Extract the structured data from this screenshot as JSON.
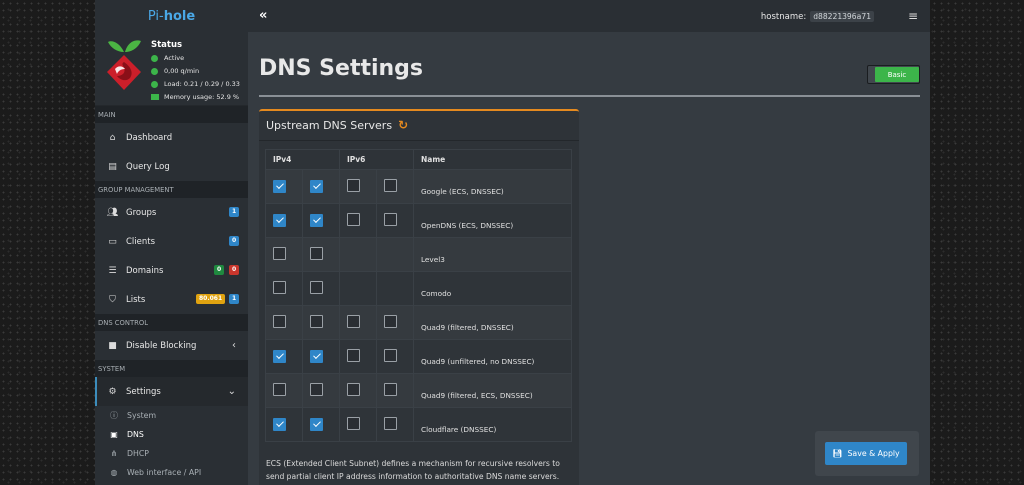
{
  "brand": {
    "prefix": "Pi-",
    "name": "hole"
  },
  "status": {
    "title": "Status",
    "active": "Active",
    "qpm": "0,00 q/min",
    "load": "Load: 0.21 / 0.29 / 0.33",
    "memory": "Memory usage: 52.9 %"
  },
  "sidebar": {
    "sections": {
      "main": "MAIN",
      "group": "GROUP MANAGEMENT",
      "dns_control": "DNS CONTROL",
      "system": "SYSTEM"
    },
    "items": {
      "dashboard": "Dashboard",
      "query_log": "Query Log",
      "groups": "Groups",
      "groups_badge": "1",
      "clients": "Clients",
      "clients_badge": "0",
      "domains": "Domains",
      "domains_badge_allow": "0",
      "domains_badge_deny": "0",
      "lists": "Lists",
      "lists_badge_domains": "80.061",
      "lists_badge_count": "1",
      "disable_blocking": "Disable Blocking",
      "settings": "Settings"
    },
    "sub": {
      "system": "System",
      "dns": "DNS",
      "dhcp": "DHCP",
      "web": "Web interface / API"
    }
  },
  "header": {
    "hostname_label": "hostname:",
    "hostname_value": "d88221396a71"
  },
  "page": {
    "title": "DNS Settings",
    "mode": "Basic"
  },
  "upstream": {
    "title": "Upstream DNS Servers",
    "columns": {
      "ipv4": "IPv4",
      "ipv6": "IPv6",
      "name": "Name"
    },
    "rows": [
      {
        "name": "Google (ECS, DNSSEC)"
      },
      {
        "name": "OpenDNS (ECS, DNSSEC)"
      },
      {
        "name": "Level3"
      },
      {
        "name": "Comodo"
      },
      {
        "name": "Quad9 (filtered, DNSSEC)"
      },
      {
        "name": "Quad9 (unfiltered, no DNSSEC)"
      },
      {
        "name": "Quad9 (filtered, ECS, DNSSEC)"
      },
      {
        "name": "Cloudflare (DNSSEC)"
      }
    ],
    "ecs_line1": "ECS (Extended Client Subnet) defines a mechanism for recursive resolvers to",
    "ecs_line2": "send partial client IP address information to authoritative DNS name servers."
  },
  "actions": {
    "save": "Save & Apply"
  },
  "colors": {
    "accent": "#2f86c8",
    "success": "#3cb54a",
    "card_border": "#e58a1f"
  }
}
